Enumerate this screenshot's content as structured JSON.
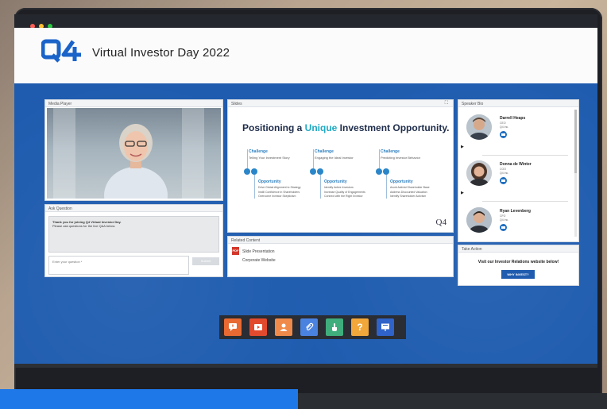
{
  "header": {
    "title": "Virtual Investor Day 2022",
    "logo": "Q4"
  },
  "panels": {
    "media_player": "Media Player",
    "ask_question": "Ask Question",
    "slides": "Slides",
    "related_content": "Related Content",
    "speaker_bio": "Speaker Bio",
    "take_action": "Take Action"
  },
  "ask": {
    "welcome_bold": "Thank you for joining Q4 Virtual Investor Day.",
    "welcome_sub": "Please ask questions for the live Q&A below.",
    "placeholder": "Enter your question *",
    "submit": "Submit"
  },
  "slide": {
    "title_pre": "Positioning a ",
    "title_hl": "Unique",
    "title_post": " Investment Opportunity.",
    "columns": [
      {
        "challenge": "Challenge",
        "challenge_sub": "Telling Your Investment Story",
        "opportunity": "Opportunity",
        "opportunity_sub": "Drive Global Alignment to Strategy\nInstill Confidence in Shareholders\nOvercome Investor Skepticism"
      },
      {
        "challenge": "Challenge",
        "challenge_sub": "Engaging the Ideal Investor",
        "opportunity": "Opportunity",
        "opportunity_sub": "Identify Active Investors\nIncrease Quality of Engagements\nConnect with the Right Investor"
      },
      {
        "challenge": "Challenge",
        "challenge_sub": "Predicting Investor Behavior",
        "opportunity": "Opportunity",
        "opportunity_sub": "Avoid Activist Shareholder Base\nAddress Discounted Valuation\nIdentify Shareholder Activism"
      }
    ],
    "watermark": "Q4"
  },
  "related": [
    {
      "label": "Slide Presentation",
      "icon": "pdf-icon"
    },
    {
      "label": "Corporate Website",
      "icon": ""
    }
  ],
  "speakers": [
    {
      "name": "Darrell Heaps",
      "role": "CEO",
      "company": "Q4 Inc."
    },
    {
      "name": "Donna de Winter",
      "role": "COO",
      "company": "Q4 Inc."
    },
    {
      "name": "Ryan Levenberg",
      "role": "CFO",
      "company": "Q4 Inc."
    }
  ],
  "action": {
    "text": "Visit our Investor Relations website below!",
    "button": "WHY INVEST?"
  },
  "toolbar": [
    {
      "icon": "qa-icon",
      "color": "#e86a32"
    },
    {
      "icon": "play-icon",
      "color": "#e24a2e"
    },
    {
      "icon": "person-icon",
      "color": "#f08a4a"
    },
    {
      "icon": "paperclip-icon",
      "color": "#4a82e0"
    },
    {
      "icon": "hand-icon",
      "color": "#3fae7c"
    },
    {
      "icon": "question-icon",
      "color": "#f2a73b"
    },
    {
      "icon": "presentation-icon",
      "color": "#2f63c9"
    }
  ]
}
